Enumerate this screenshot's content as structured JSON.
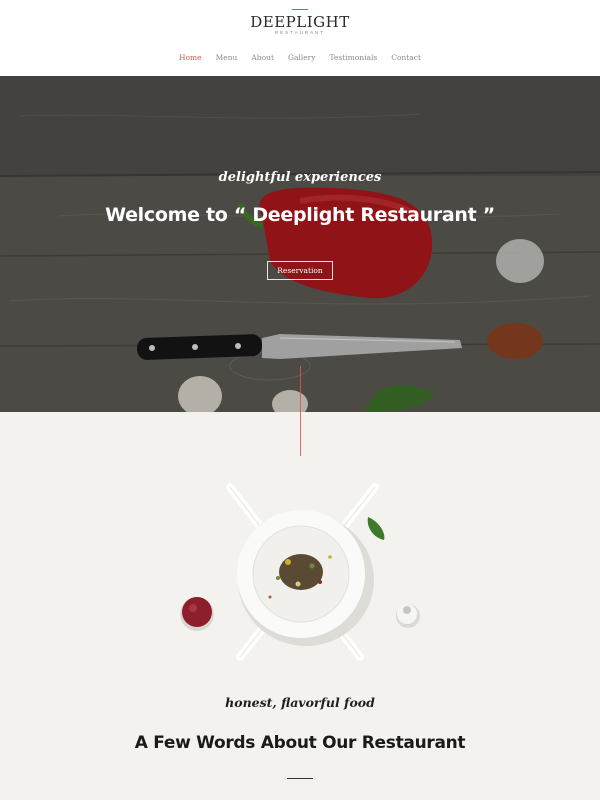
{
  "brand": {
    "name": "DEEPLIGHT",
    "subtitle": "RESTAURANT",
    "accent_color": "#d9534f"
  },
  "nav": {
    "items": [
      {
        "label": "Home",
        "active": true
      },
      {
        "label": "Menu",
        "active": false
      },
      {
        "label": "About",
        "active": false
      },
      {
        "label": "Gallery",
        "active": false
      },
      {
        "label": "Testimonials",
        "active": false
      },
      {
        "label": "Contact",
        "active": false
      }
    ]
  },
  "hero": {
    "tagline": "delightful experiences",
    "title": "Welcome to “ Deeplight Restaurant ”",
    "button_label": "Reservation"
  },
  "about": {
    "tagline": "honest, flavorful food",
    "title": "A Few Words About Our Restaurant"
  }
}
